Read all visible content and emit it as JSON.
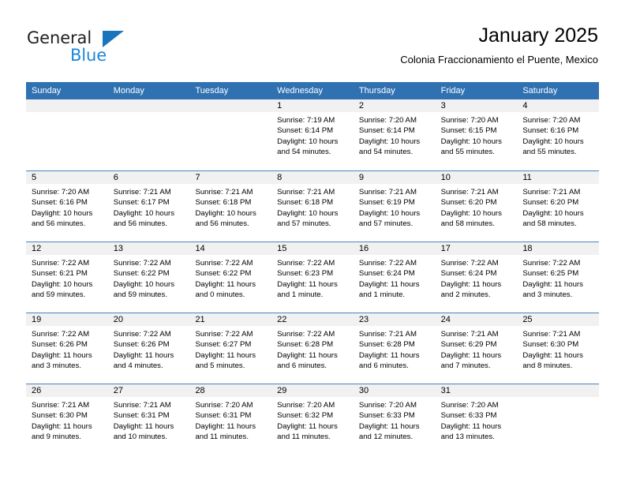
{
  "brand": {
    "name_part1": "General",
    "name_part2": "Blue"
  },
  "header": {
    "title": "January 2025",
    "subtitle": "Colonia Fraccionamiento el Puente, Mexico"
  },
  "colors": {
    "header_blue": "#3071b2",
    "row_divider": "#4a84bd",
    "daynum_band": "#f1f1f1",
    "logo_blue": "#1b87dc",
    "logo_dark": "#231f20"
  },
  "weekdays": [
    "Sunday",
    "Monday",
    "Tuesday",
    "Wednesday",
    "Thursday",
    "Friday",
    "Saturday"
  ],
  "weeks": [
    [
      {
        "day": "",
        "lines": []
      },
      {
        "day": "",
        "lines": []
      },
      {
        "day": "",
        "lines": []
      },
      {
        "day": "1",
        "lines": [
          "Sunrise: 7:19 AM",
          "Sunset: 6:14 PM",
          "Daylight: 10 hours",
          "and 54 minutes."
        ]
      },
      {
        "day": "2",
        "lines": [
          "Sunrise: 7:20 AM",
          "Sunset: 6:14 PM",
          "Daylight: 10 hours",
          "and 54 minutes."
        ]
      },
      {
        "day": "3",
        "lines": [
          "Sunrise: 7:20 AM",
          "Sunset: 6:15 PM",
          "Daylight: 10 hours",
          "and 55 minutes."
        ]
      },
      {
        "day": "4",
        "lines": [
          "Sunrise: 7:20 AM",
          "Sunset: 6:16 PM",
          "Daylight: 10 hours",
          "and 55 minutes."
        ]
      }
    ],
    [
      {
        "day": "5",
        "lines": [
          "Sunrise: 7:20 AM",
          "Sunset: 6:16 PM",
          "Daylight: 10 hours",
          "and 56 minutes."
        ]
      },
      {
        "day": "6",
        "lines": [
          "Sunrise: 7:21 AM",
          "Sunset: 6:17 PM",
          "Daylight: 10 hours",
          "and 56 minutes."
        ]
      },
      {
        "day": "7",
        "lines": [
          "Sunrise: 7:21 AM",
          "Sunset: 6:18 PM",
          "Daylight: 10 hours",
          "and 56 minutes."
        ]
      },
      {
        "day": "8",
        "lines": [
          "Sunrise: 7:21 AM",
          "Sunset: 6:18 PM",
          "Daylight: 10 hours",
          "and 57 minutes."
        ]
      },
      {
        "day": "9",
        "lines": [
          "Sunrise: 7:21 AM",
          "Sunset: 6:19 PM",
          "Daylight: 10 hours",
          "and 57 minutes."
        ]
      },
      {
        "day": "10",
        "lines": [
          "Sunrise: 7:21 AM",
          "Sunset: 6:20 PM",
          "Daylight: 10 hours",
          "and 58 minutes."
        ]
      },
      {
        "day": "11",
        "lines": [
          "Sunrise: 7:21 AM",
          "Sunset: 6:20 PM",
          "Daylight: 10 hours",
          "and 58 minutes."
        ]
      }
    ],
    [
      {
        "day": "12",
        "lines": [
          "Sunrise: 7:22 AM",
          "Sunset: 6:21 PM",
          "Daylight: 10 hours",
          "and 59 minutes."
        ]
      },
      {
        "day": "13",
        "lines": [
          "Sunrise: 7:22 AM",
          "Sunset: 6:22 PM",
          "Daylight: 10 hours",
          "and 59 minutes."
        ]
      },
      {
        "day": "14",
        "lines": [
          "Sunrise: 7:22 AM",
          "Sunset: 6:22 PM",
          "Daylight: 11 hours",
          "and 0 minutes."
        ]
      },
      {
        "day": "15",
        "lines": [
          "Sunrise: 7:22 AM",
          "Sunset: 6:23 PM",
          "Daylight: 11 hours",
          "and 1 minute."
        ]
      },
      {
        "day": "16",
        "lines": [
          "Sunrise: 7:22 AM",
          "Sunset: 6:24 PM",
          "Daylight: 11 hours",
          "and 1 minute."
        ]
      },
      {
        "day": "17",
        "lines": [
          "Sunrise: 7:22 AM",
          "Sunset: 6:24 PM",
          "Daylight: 11 hours",
          "and 2 minutes."
        ]
      },
      {
        "day": "18",
        "lines": [
          "Sunrise: 7:22 AM",
          "Sunset: 6:25 PM",
          "Daylight: 11 hours",
          "and 3 minutes."
        ]
      }
    ],
    [
      {
        "day": "19",
        "lines": [
          "Sunrise: 7:22 AM",
          "Sunset: 6:26 PM",
          "Daylight: 11 hours",
          "and 3 minutes."
        ]
      },
      {
        "day": "20",
        "lines": [
          "Sunrise: 7:22 AM",
          "Sunset: 6:26 PM",
          "Daylight: 11 hours",
          "and 4 minutes."
        ]
      },
      {
        "day": "21",
        "lines": [
          "Sunrise: 7:22 AM",
          "Sunset: 6:27 PM",
          "Daylight: 11 hours",
          "and 5 minutes."
        ]
      },
      {
        "day": "22",
        "lines": [
          "Sunrise: 7:22 AM",
          "Sunset: 6:28 PM",
          "Daylight: 11 hours",
          "and 6 minutes."
        ]
      },
      {
        "day": "23",
        "lines": [
          "Sunrise: 7:21 AM",
          "Sunset: 6:28 PM",
          "Daylight: 11 hours",
          "and 6 minutes."
        ]
      },
      {
        "day": "24",
        "lines": [
          "Sunrise: 7:21 AM",
          "Sunset: 6:29 PM",
          "Daylight: 11 hours",
          "and 7 minutes."
        ]
      },
      {
        "day": "25",
        "lines": [
          "Sunrise: 7:21 AM",
          "Sunset: 6:30 PM",
          "Daylight: 11 hours",
          "and 8 minutes."
        ]
      }
    ],
    [
      {
        "day": "26",
        "lines": [
          "Sunrise: 7:21 AM",
          "Sunset: 6:30 PM",
          "Daylight: 11 hours",
          "and 9 minutes."
        ]
      },
      {
        "day": "27",
        "lines": [
          "Sunrise: 7:21 AM",
          "Sunset: 6:31 PM",
          "Daylight: 11 hours",
          "and 10 minutes."
        ]
      },
      {
        "day": "28",
        "lines": [
          "Sunrise: 7:20 AM",
          "Sunset: 6:31 PM",
          "Daylight: 11 hours",
          "and 11 minutes."
        ]
      },
      {
        "day": "29",
        "lines": [
          "Sunrise: 7:20 AM",
          "Sunset: 6:32 PM",
          "Daylight: 11 hours",
          "and 11 minutes."
        ]
      },
      {
        "day": "30",
        "lines": [
          "Sunrise: 7:20 AM",
          "Sunset: 6:33 PM",
          "Daylight: 11 hours",
          "and 12 minutes."
        ]
      },
      {
        "day": "31",
        "lines": [
          "Sunrise: 7:20 AM",
          "Sunset: 6:33 PM",
          "Daylight: 11 hours",
          "and 13 minutes."
        ]
      },
      {
        "day": "",
        "lines": []
      }
    ]
  ]
}
